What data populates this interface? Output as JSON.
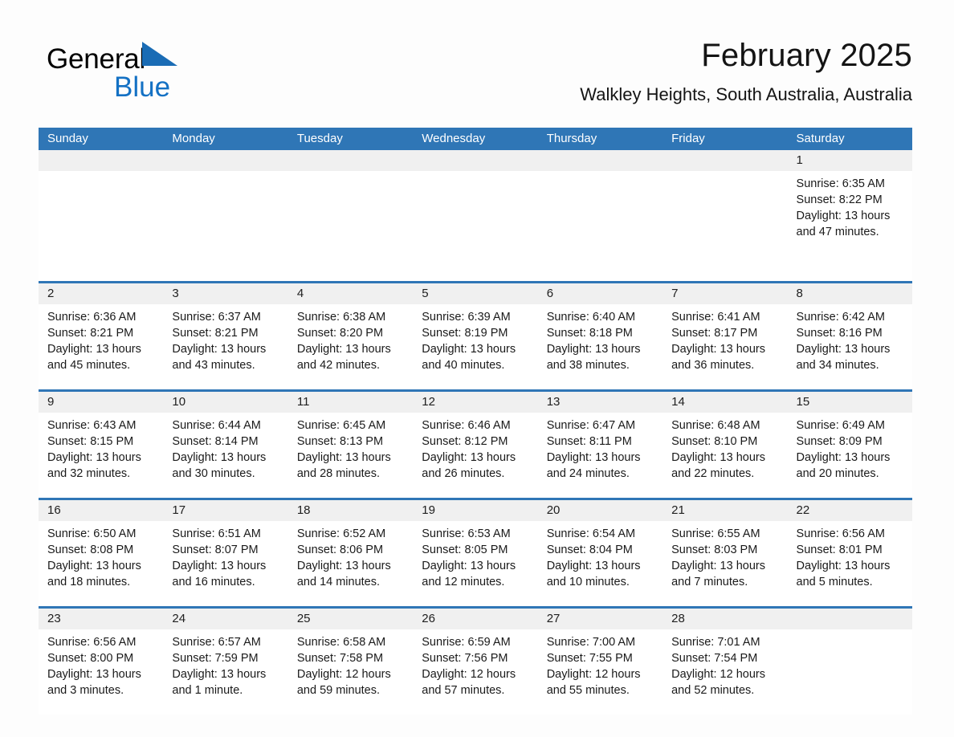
{
  "brand": {
    "name_part1": "General",
    "name_part2": "Blue",
    "triangle_icon": "triangle-icon",
    "accent_color": "#1471c4"
  },
  "header": {
    "title": "February 2025",
    "location": "Walkley Heights, South Australia, Australia"
  },
  "theme": {
    "header_blue": "#2f76b6",
    "daynum_band": "#f0f0f0",
    "page_background": "#fdfdfd",
    "text": "#1a1a1a"
  },
  "weekdays": [
    "Sunday",
    "Monday",
    "Tuesday",
    "Wednesday",
    "Thursday",
    "Friday",
    "Saturday"
  ],
  "weeks": [
    {
      "days": [
        {
          "num": "",
          "empty": true
        },
        {
          "num": "",
          "empty": true
        },
        {
          "num": "",
          "empty": true
        },
        {
          "num": "",
          "empty": true
        },
        {
          "num": "",
          "empty": true
        },
        {
          "num": "",
          "empty": true
        },
        {
          "num": "1",
          "sunrise": "Sunrise: 6:35 AM",
          "sunset": "Sunset: 8:22 PM",
          "daylight": "Daylight: 13 hours and 47 minutes."
        }
      ]
    },
    {
      "days": [
        {
          "num": "2",
          "sunrise": "Sunrise: 6:36 AM",
          "sunset": "Sunset: 8:21 PM",
          "daylight": "Daylight: 13 hours and 45 minutes."
        },
        {
          "num": "3",
          "sunrise": "Sunrise: 6:37 AM",
          "sunset": "Sunset: 8:21 PM",
          "daylight": "Daylight: 13 hours and 43 minutes."
        },
        {
          "num": "4",
          "sunrise": "Sunrise: 6:38 AM",
          "sunset": "Sunset: 8:20 PM",
          "daylight": "Daylight: 13 hours and 42 minutes."
        },
        {
          "num": "5",
          "sunrise": "Sunrise: 6:39 AM",
          "sunset": "Sunset: 8:19 PM",
          "daylight": "Daylight: 13 hours and 40 minutes."
        },
        {
          "num": "6",
          "sunrise": "Sunrise: 6:40 AM",
          "sunset": "Sunset: 8:18 PM",
          "daylight": "Daylight: 13 hours and 38 minutes."
        },
        {
          "num": "7",
          "sunrise": "Sunrise: 6:41 AM",
          "sunset": "Sunset: 8:17 PM",
          "daylight": "Daylight: 13 hours and 36 minutes."
        },
        {
          "num": "8",
          "sunrise": "Sunrise: 6:42 AM",
          "sunset": "Sunset: 8:16 PM",
          "daylight": "Daylight: 13 hours and 34 minutes."
        }
      ]
    },
    {
      "days": [
        {
          "num": "9",
          "sunrise": "Sunrise: 6:43 AM",
          "sunset": "Sunset: 8:15 PM",
          "daylight": "Daylight: 13 hours and 32 minutes."
        },
        {
          "num": "10",
          "sunrise": "Sunrise: 6:44 AM",
          "sunset": "Sunset: 8:14 PM",
          "daylight": "Daylight: 13 hours and 30 minutes."
        },
        {
          "num": "11",
          "sunrise": "Sunrise: 6:45 AM",
          "sunset": "Sunset: 8:13 PM",
          "daylight": "Daylight: 13 hours and 28 minutes."
        },
        {
          "num": "12",
          "sunrise": "Sunrise: 6:46 AM",
          "sunset": "Sunset: 8:12 PM",
          "daylight": "Daylight: 13 hours and 26 minutes."
        },
        {
          "num": "13",
          "sunrise": "Sunrise: 6:47 AM",
          "sunset": "Sunset: 8:11 PM",
          "daylight": "Daylight: 13 hours and 24 minutes."
        },
        {
          "num": "14",
          "sunrise": "Sunrise: 6:48 AM",
          "sunset": "Sunset: 8:10 PM",
          "daylight": "Daylight: 13 hours and 22 minutes."
        },
        {
          "num": "15",
          "sunrise": "Sunrise: 6:49 AM",
          "sunset": "Sunset: 8:09 PM",
          "daylight": "Daylight: 13 hours and 20 minutes."
        }
      ]
    },
    {
      "days": [
        {
          "num": "16",
          "sunrise": "Sunrise: 6:50 AM",
          "sunset": "Sunset: 8:08 PM",
          "daylight": "Daylight: 13 hours and 18 minutes."
        },
        {
          "num": "17",
          "sunrise": "Sunrise: 6:51 AM",
          "sunset": "Sunset: 8:07 PM",
          "daylight": "Daylight: 13 hours and 16 minutes."
        },
        {
          "num": "18",
          "sunrise": "Sunrise: 6:52 AM",
          "sunset": "Sunset: 8:06 PM",
          "daylight": "Daylight: 13 hours and 14 minutes."
        },
        {
          "num": "19",
          "sunrise": "Sunrise: 6:53 AM",
          "sunset": "Sunset: 8:05 PM",
          "daylight": "Daylight: 13 hours and 12 minutes."
        },
        {
          "num": "20",
          "sunrise": "Sunrise: 6:54 AM",
          "sunset": "Sunset: 8:04 PM",
          "daylight": "Daylight: 13 hours and 10 minutes."
        },
        {
          "num": "21",
          "sunrise": "Sunrise: 6:55 AM",
          "sunset": "Sunset: 8:03 PM",
          "daylight": "Daylight: 13 hours and 7 minutes."
        },
        {
          "num": "22",
          "sunrise": "Sunrise: 6:56 AM",
          "sunset": "Sunset: 8:01 PM",
          "daylight": "Daylight: 13 hours and 5 minutes."
        }
      ]
    },
    {
      "days": [
        {
          "num": "23",
          "sunrise": "Sunrise: 6:56 AM",
          "sunset": "Sunset: 8:00 PM",
          "daylight": "Daylight: 13 hours and 3 minutes."
        },
        {
          "num": "24",
          "sunrise": "Sunrise: 6:57 AM",
          "sunset": "Sunset: 7:59 PM",
          "daylight": "Daylight: 13 hours and 1 minute."
        },
        {
          "num": "25",
          "sunrise": "Sunrise: 6:58 AM",
          "sunset": "Sunset: 7:58 PM",
          "daylight": "Daylight: 12 hours and 59 minutes."
        },
        {
          "num": "26",
          "sunrise": "Sunrise: 6:59 AM",
          "sunset": "Sunset: 7:56 PM",
          "daylight": "Daylight: 12 hours and 57 minutes."
        },
        {
          "num": "27",
          "sunrise": "Sunrise: 7:00 AM",
          "sunset": "Sunset: 7:55 PM",
          "daylight": "Daylight: 12 hours and 55 minutes."
        },
        {
          "num": "28",
          "sunrise": "Sunrise: 7:01 AM",
          "sunset": "Sunset: 7:54 PM",
          "daylight": "Daylight: 12 hours and 52 minutes."
        },
        {
          "num": "",
          "empty": true,
          "trailing": true
        }
      ]
    }
  ]
}
